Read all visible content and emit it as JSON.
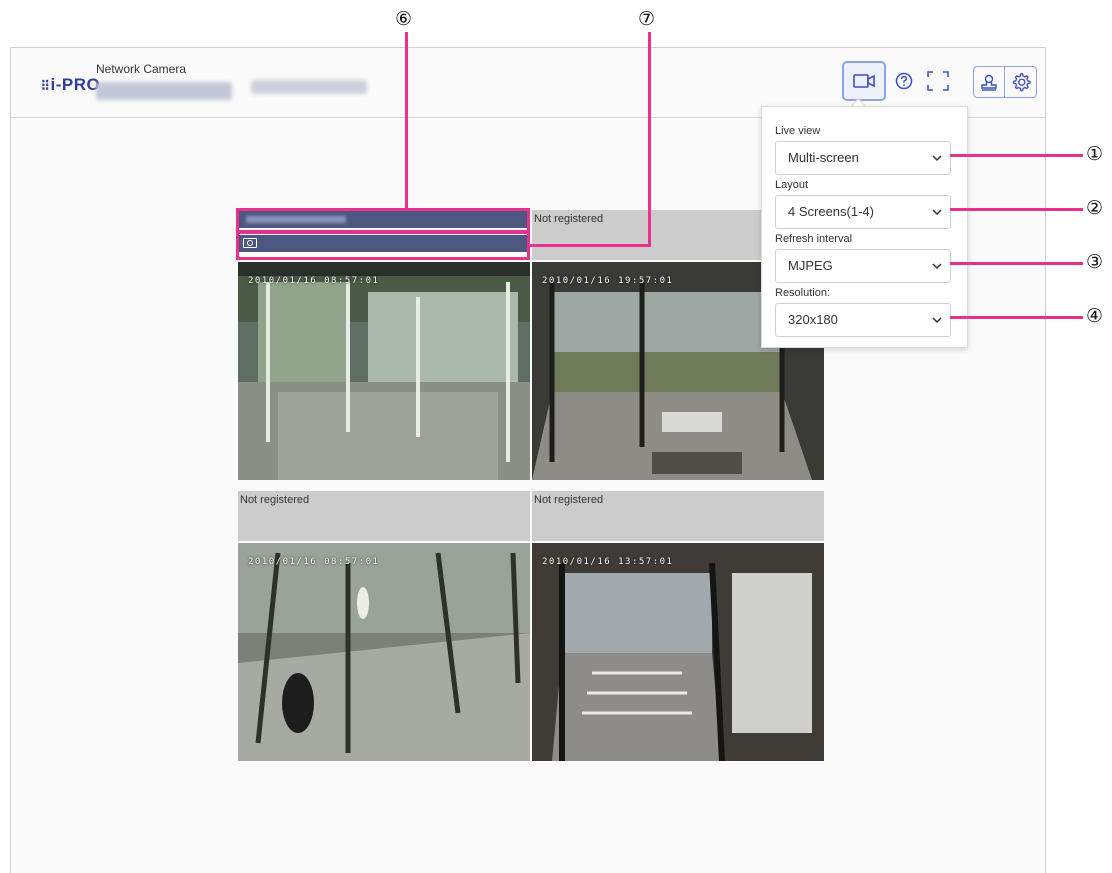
{
  "header": {
    "logo": "i-PRO",
    "product": "Network Camera",
    "icons": {
      "live": "video-camera-icon",
      "help": "help-circle-icon",
      "fullscreen": "fullscreen-icon",
      "user": "user-stamp-icon",
      "settings": "gear-icon"
    }
  },
  "popup": {
    "live_view_label": "Live view",
    "live_view_value": "Multi-screen",
    "layout_label": "Layout",
    "layout_value": "4 Screens(1-4)",
    "refresh_label": "Refresh interval",
    "refresh_value": "MJPEG",
    "resolution_label": "Resolution:",
    "resolution_value": "320x180"
  },
  "tiles": [
    {
      "label": "",
      "timestamp": "2010/01/16 08:57:01"
    },
    {
      "label": "Not registered",
      "timestamp": "2010/01/16 19:57:01"
    },
    {
      "label": "Not registered",
      "timestamp": "2010/01/16 08:57:01"
    },
    {
      "label": "Not registered",
      "timestamp": "2010/01/16 13:57:01"
    }
  ],
  "callouts": {
    "c1": "①",
    "c2": "②",
    "c3": "③",
    "c4": "④",
    "c6": "⑥",
    "c7": "⑦"
  },
  "colors": {
    "accent": "#8ea2e8",
    "logo": "#2f3e9e",
    "annotation": "#e8318a",
    "tile_bar": "#4d5781"
  }
}
